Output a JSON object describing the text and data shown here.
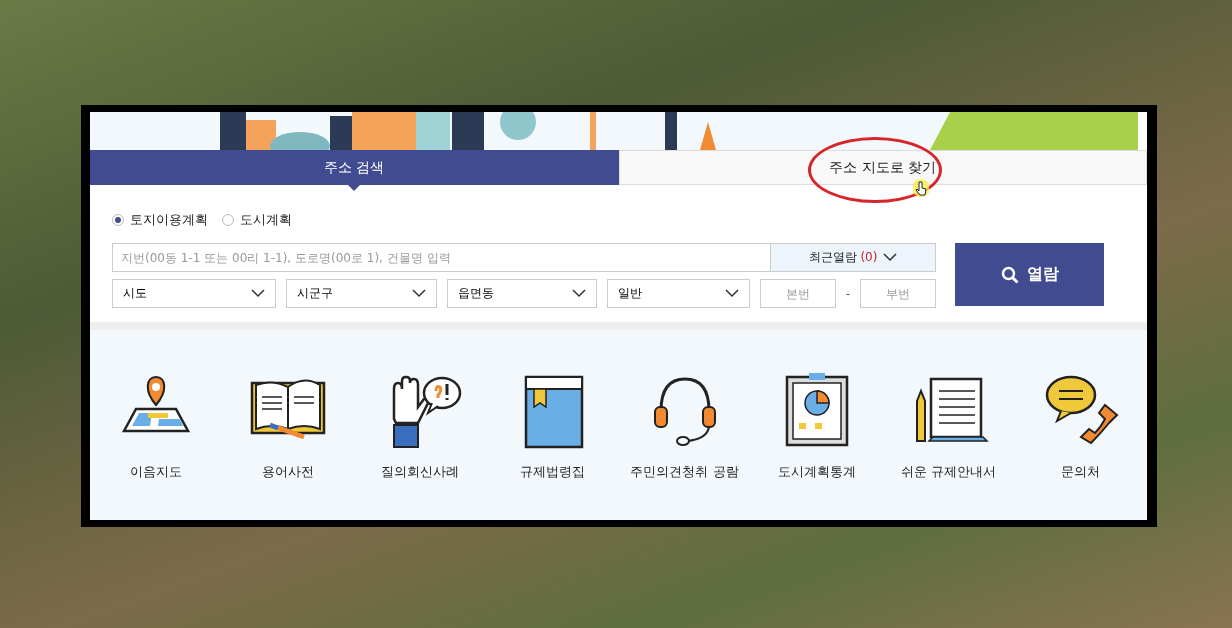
{
  "tabs": [
    {
      "label": "주소 검색",
      "selected": true
    },
    {
      "label": "주소 지도로 찾기",
      "selected": false
    }
  ],
  "plan_types": [
    {
      "label": "토지이용계획",
      "selected": true
    },
    {
      "label": "도시계획",
      "selected": false
    }
  ],
  "search": {
    "placeholder": "지번(00동 1-1 또는 00리 1-1), 도로명(00로 1), 건물명 입력"
  },
  "recent": {
    "label": "최근열람",
    "count": "(0)"
  },
  "selects": [
    "시도",
    "시군구",
    "읍면동",
    "일반"
  ],
  "lot_number": {
    "main_placeholder": "본번",
    "separator": "-",
    "sub_placeholder": "부번"
  },
  "view_button": "열람",
  "quick_links": [
    "이음지도",
    "용어사전",
    "질의회신사례",
    "규제법령집",
    "주민의견청취 공람",
    "도시계획통계",
    "쉬운 규제안내서",
    "문의처"
  ]
}
